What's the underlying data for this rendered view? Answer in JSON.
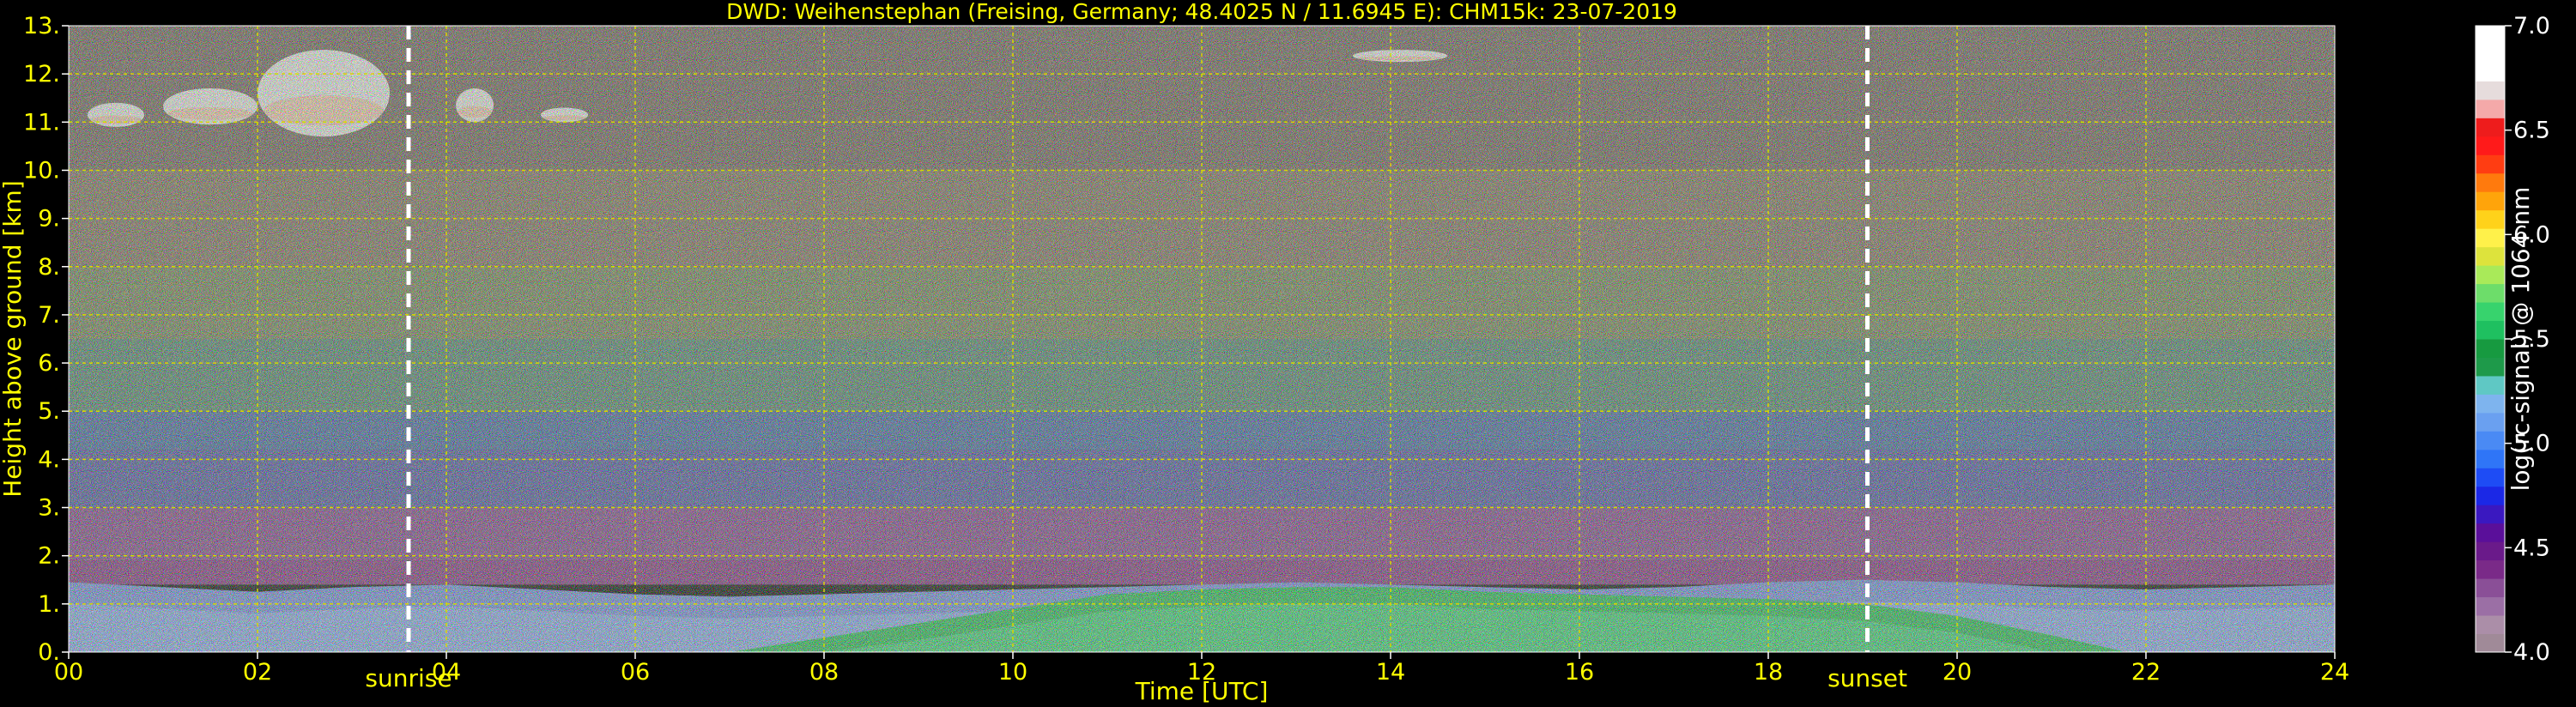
{
  "chart_data": {
    "type": "heatmap",
    "title": "DWD: Weihenstephan (Freising, Germany; 48.4025 N / 11.6945 E):    CHM15k: 23-07-2019",
    "xlabel": "Time [UTC]",
    "ylabel": "Height above ground [km]",
    "colorbar_label": "log(rc-signal) @ 1064 nm",
    "xlim": [
      0,
      24
    ],
    "ylim": [
      0,
      13
    ],
    "x_ticks": [
      0,
      2,
      4,
      6,
      8,
      10,
      12,
      14,
      16,
      18,
      20,
      22,
      24
    ],
    "x_tick_labels": [
      "00",
      "02",
      "04",
      "06",
      "08",
      "10",
      "12",
      "14",
      "16",
      "18",
      "20",
      "22",
      "24"
    ],
    "y_ticks": [
      0,
      1,
      2,
      3,
      4,
      5,
      6,
      7,
      8,
      9,
      10,
      11,
      12,
      13
    ],
    "y_tick_labels": [
      "0.",
      "1.",
      "2.",
      "3.",
      "4.",
      "5.",
      "6.",
      "7.",
      "8.",
      "9.",
      "10.",
      "11.",
      "12.",
      "13."
    ],
    "grid": true,
    "colorbar_range": [
      4.0,
      7.0
    ],
    "colorbar_ticks": [
      4.0,
      4.5,
      5.0,
      5.5,
      6.0,
      6.5,
      7.0
    ],
    "colorbar_tick_labels": [
      "4.0",
      "4.5",
      "5.0",
      "5.5",
      "6.0",
      "6.5",
      "7.0"
    ],
    "colorbar_colors": [
      "#a08a98",
      "#ab8ea8",
      "#9b6fa5",
      "#8a4f97",
      "#7a2a88",
      "#6a1a8a",
      "#5a0f9a",
      "#3a18c0",
      "#1b28e6",
      "#1e4cf5",
      "#2f75f7",
      "#4a8af4",
      "#6aa0f0",
      "#7eb4ee",
      "#5fc8c4",
      "#1e9a4a",
      "#179a40",
      "#1fc060",
      "#37d36d",
      "#6ddd6a",
      "#a9ea59",
      "#dde33c",
      "#fff14a",
      "#ffd21a",
      "#ffa40a",
      "#ff7a0d",
      "#ff3d12",
      "#ff1a1a",
      "#ee1c1c",
      "#f4a9a9",
      "#e6dcdc",
      "#ffffff",
      "#ffffff",
      "#ffffff"
    ],
    "events": [
      {
        "label": "sunrise",
        "time": 3.6
      },
      {
        "label": "sunset",
        "time": 19.05
      }
    ],
    "background_layers": [
      {
        "from": 1.4,
        "to": 1.9,
        "color": "#7a2e7a"
      },
      {
        "from": 1.9,
        "to": 3.0,
        "color": "#7b3f86"
      },
      {
        "from": 3.0,
        "to": 4.2,
        "color": "#4a4f9a"
      },
      {
        "from": 4.2,
        "to": 5.0,
        "color": "#3f5f9a"
      },
      {
        "from": 5.0,
        "to": 6.5,
        "color": "#4f7a6a"
      },
      {
        "from": 6.5,
        "to": 8.0,
        "color": "#6f7a55"
      },
      {
        "from": 8.0,
        "to": 10.0,
        "color": "#7a6a5a"
      },
      {
        "from": 10.0,
        "to": 13.0,
        "color": "#6a5a55"
      }
    ],
    "boundary_layer_top_km": [
      [
        0,
        1.45
      ],
      [
        1,
        1.35
      ],
      [
        2,
        1.25
      ],
      [
        3,
        1.35
      ],
      [
        4,
        1.4
      ],
      [
        5,
        1.3
      ],
      [
        6,
        1.2
      ],
      [
        7,
        1.15
      ],
      [
        8,
        1.2
      ],
      [
        9,
        1.25
      ],
      [
        10,
        1.3
      ],
      [
        11,
        1.35
      ],
      [
        12,
        1.4
      ],
      [
        13,
        1.45
      ],
      [
        14,
        1.4
      ],
      [
        15,
        1.35
      ],
      [
        16,
        1.3
      ],
      [
        17,
        1.35
      ],
      [
        18,
        1.45
      ],
      [
        19,
        1.5
      ],
      [
        20,
        1.45
      ],
      [
        21,
        1.35
      ],
      [
        22,
        1.3
      ],
      [
        23,
        1.35
      ],
      [
        24,
        1.4
      ]
    ],
    "mixed_layer_top_km": [
      [
        7,
        0.0
      ],
      [
        8,
        0.3
      ],
      [
        9,
        0.6
      ],
      [
        10,
        0.9
      ],
      [
        11,
        1.2
      ],
      [
        12,
        1.3
      ],
      [
        13,
        1.35
      ],
      [
        14,
        1.35
      ],
      [
        15,
        1.25
      ],
      [
        16,
        1.2
      ],
      [
        17,
        1.15
      ],
      [
        18,
        1.1
      ],
      [
        19,
        1.0
      ],
      [
        20,
        0.75
      ],
      [
        21,
        0.35
      ],
      [
        21.8,
        0.0
      ]
    ],
    "clouds": [
      {
        "t_start": 0.2,
        "t_end": 0.8,
        "h_bottom": 10.9,
        "h_top": 11.4
      },
      {
        "t_start": 1.0,
        "t_end": 2.0,
        "h_bottom": 10.95,
        "h_top": 11.7
      },
      {
        "t_start": 2.0,
        "t_end": 3.4,
        "h_bottom": 10.7,
        "h_top": 12.5
      },
      {
        "t_start": 4.1,
        "t_end": 4.5,
        "h_bottom": 11.0,
        "h_top": 11.7
      },
      {
        "t_start": 5.0,
        "t_end": 5.5,
        "h_bottom": 11.0,
        "h_top": 11.3
      },
      {
        "t_start": 13.6,
        "t_end": 14.6,
        "h_bottom": 12.25,
        "h_top": 12.5
      }
    ]
  }
}
